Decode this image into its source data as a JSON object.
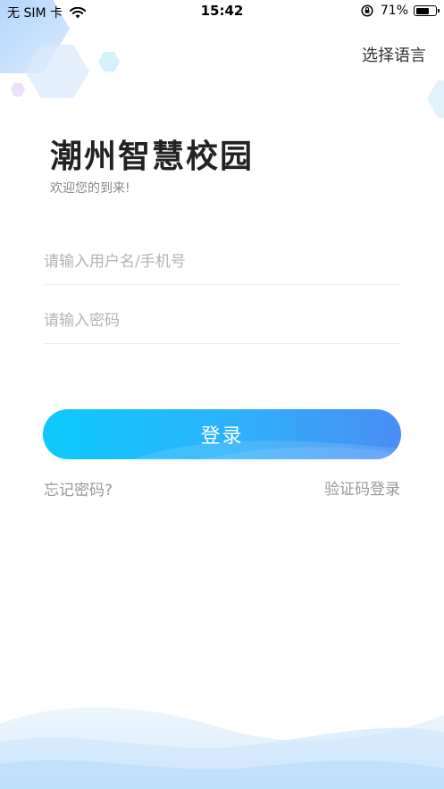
{
  "status_bar": {
    "carrier": "无 SIM 卡",
    "time": "15:42",
    "battery_percent": "71%",
    "battery_level": 0.71,
    "icons": [
      "wifi-icon",
      "rotation-lock-icon",
      "battery-icon"
    ]
  },
  "header": {
    "language_label": "选择语言"
  },
  "title": "潮州智慧校园",
  "subtitle": "欢迎您的到来!",
  "form": {
    "username_placeholder": "请输入用户名/手机号",
    "username_value": "",
    "password_placeholder": "请输入密码",
    "password_value": ""
  },
  "login_button": "登录",
  "links": {
    "forgot_password": "忘记密码?",
    "sms_login": "验证码登录"
  },
  "colors": {
    "button_start": "#0ccafc",
    "button_end": "#4a8df4",
    "wave": "#cfe7fb",
    "hexagon": "#a9cdf9"
  }
}
